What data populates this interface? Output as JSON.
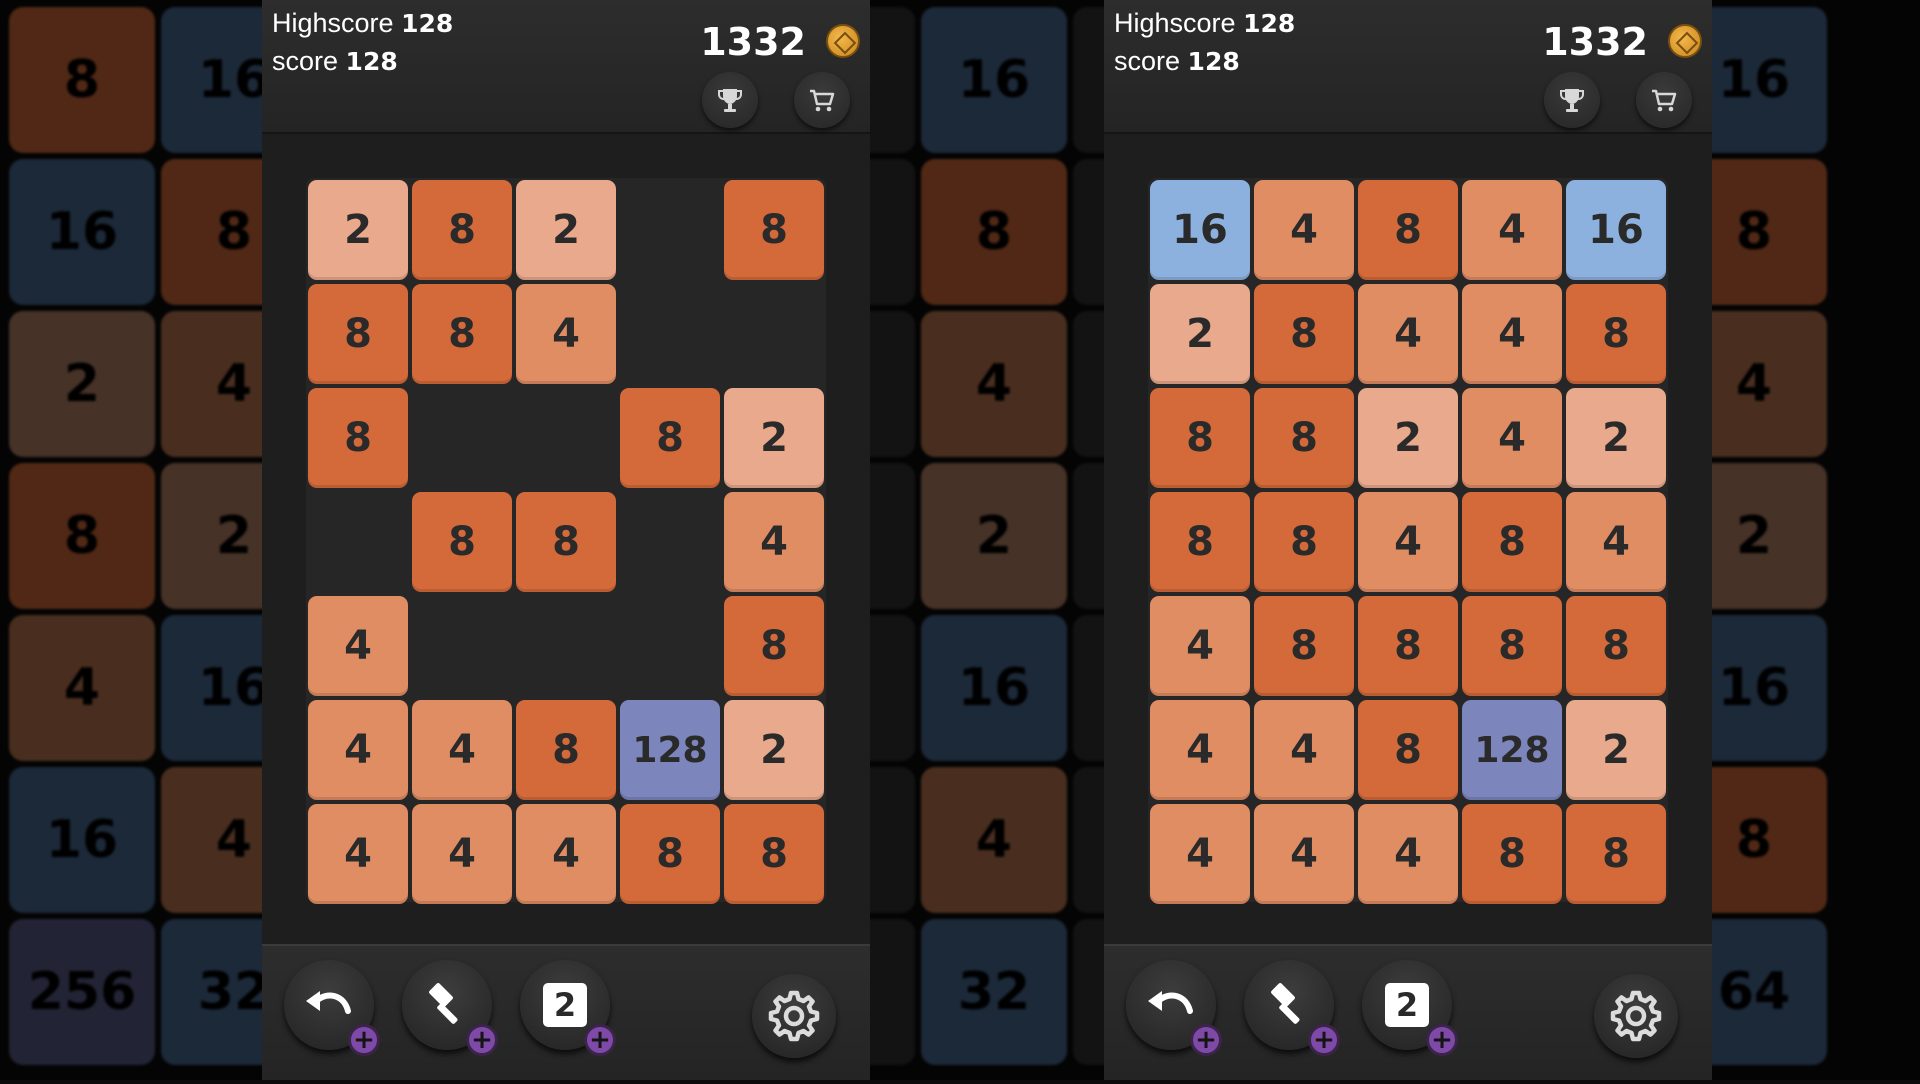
{
  "colors": {
    "2": "#e8a98c",
    "4": "#e08d63",
    "8": "#d46a3a",
    "16": "#8db1de",
    "128": "#7d85bd",
    "empty": "#262626"
  },
  "background": {
    "cells": [
      [
        "8",
        "16",
        "",
        "",
        "",
        "",
        "16",
        "",
        "",
        "",
        "",
        "16"
      ],
      [
        "16",
        "8",
        "",
        "",
        "",
        "",
        "8",
        "",
        "",
        "",
        "",
        "8"
      ],
      [
        "2",
        "4",
        "",
        "",
        "",
        "",
        "4",
        "",
        "",
        "",
        "",
        "4"
      ],
      [
        "8",
        "2",
        "",
        "",
        "",
        "",
        "2",
        "",
        "",
        "",
        "",
        "2"
      ],
      [
        "4",
        "16",
        "",
        "",
        "",
        "",
        "16",
        "",
        "",
        "",
        "",
        "16"
      ],
      [
        "16",
        "4",
        "",
        "",
        "",
        "",
        "4",
        "",
        "",
        "",
        "",
        "8"
      ],
      [
        "256",
        "32",
        "",
        "",
        "",
        "",
        "32",
        "",
        "",
        "",
        "",
        "64"
      ]
    ],
    "colors": [
      [
        "#d46a3a",
        "#4a6d96",
        "#333",
        "#333",
        "#333",
        "#333",
        "#4a6d96",
        "#333",
        "#333",
        "#333",
        "#333",
        "#4a6d96"
      ],
      [
        "#4a6d96",
        "#d46a3a",
        "#333",
        "#333",
        "#333",
        "#333",
        "#d46a3a",
        "#333",
        "#333",
        "#333",
        "#333",
        "#d46a3a"
      ],
      [
        "#b88568",
        "#c07a53",
        "#333",
        "#333",
        "#333",
        "#333",
        "#c07a53",
        "#333",
        "#333",
        "#333",
        "#333",
        "#c07a53"
      ],
      [
        "#d46a3a",
        "#b88568",
        "#333",
        "#333",
        "#333",
        "#333",
        "#b88568",
        "#333",
        "#333",
        "#333",
        "#333",
        "#b88568"
      ],
      [
        "#c07a53",
        "#4a6d96",
        "#333",
        "#333",
        "#333",
        "#333",
        "#4a6d96",
        "#333",
        "#333",
        "#333",
        "#333",
        "#4a6d96"
      ],
      [
        "#4a6d96",
        "#c07a53",
        "#333",
        "#333",
        "#333",
        "#333",
        "#c07a53",
        "#333",
        "#333",
        "#333",
        "#333",
        "#d46a3a"
      ],
      [
        "#5a5f8c",
        "#4a6d96",
        "#333",
        "#333",
        "#333",
        "#333",
        "#4a6d96",
        "#333",
        "#333",
        "#333",
        "#333",
        "#4a6d96"
      ]
    ]
  },
  "left": {
    "highscore_label": "Highscore",
    "highscore_value": "128",
    "score_label": "score",
    "score_value": "128",
    "coins": "1332",
    "board": [
      [
        "2",
        "8",
        "2",
        "",
        "8"
      ],
      [
        "8",
        "8",
        "4",
        "",
        ""
      ],
      [
        "8",
        "",
        "",
        "8",
        "2"
      ],
      [
        "",
        "8",
        "8",
        "",
        "4"
      ],
      [
        "4",
        "",
        "",
        "",
        "8"
      ],
      [
        "4",
        "4",
        "8",
        "128",
        "2"
      ],
      [
        "4",
        "4",
        "4",
        "8",
        "8"
      ]
    ],
    "tools": {
      "swap_value": "2"
    }
  },
  "right": {
    "highscore_label": "Highscore",
    "highscore_value": "128",
    "score_label": "score",
    "score_value": "128",
    "coins": "1332",
    "board": [
      [
        "16",
        "4",
        "8",
        "4",
        "16"
      ],
      [
        "2",
        "8",
        "4",
        "4",
        "8"
      ],
      [
        "8",
        "8",
        "2",
        "4",
        "2"
      ],
      [
        "8",
        "8",
        "4",
        "8",
        "4"
      ],
      [
        "4",
        "8",
        "8",
        "8",
        "8"
      ],
      [
        "4",
        "4",
        "8",
        "128",
        "2"
      ],
      [
        "4",
        "4",
        "4",
        "8",
        "8"
      ]
    ],
    "tools": {
      "swap_value": "2"
    }
  },
  "icons": {
    "coin": "coin-icon",
    "trophy": "trophy-icon",
    "cart": "cart-icon",
    "undo": "undo-icon",
    "hammer": "hammer-icon",
    "plus": "plus-icon",
    "settings": "gear-icon"
  }
}
